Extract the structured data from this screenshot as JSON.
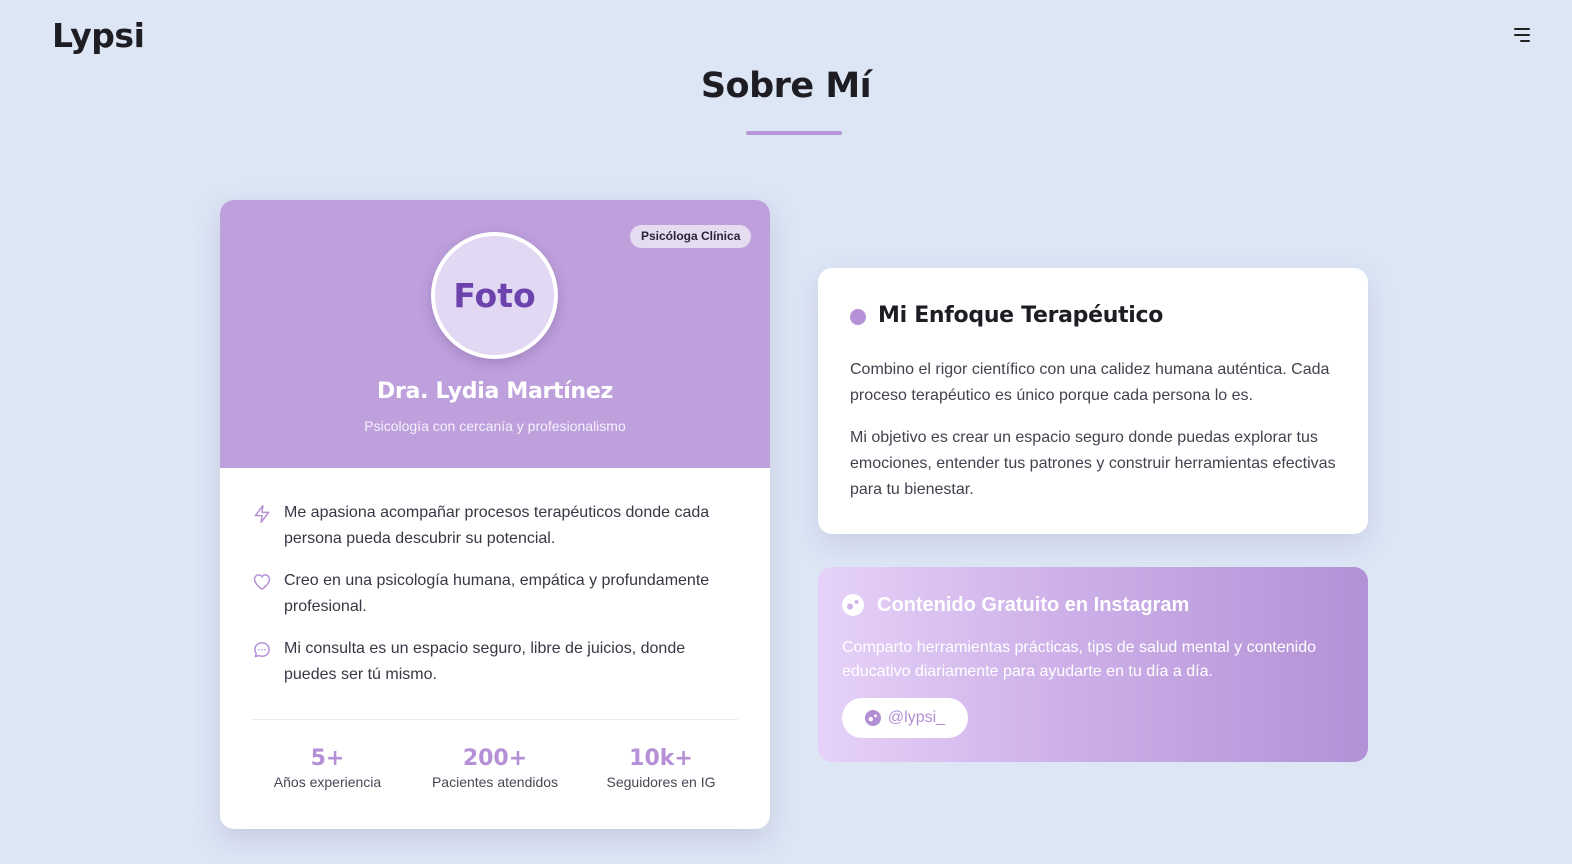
{
  "header": {
    "logo": "Lypsi",
    "menu_icon": "hamburger-menu-icon"
  },
  "section": {
    "title": "Sobre Mí"
  },
  "profile": {
    "badge": "Psicóloga Clínica",
    "photo_label": "Foto",
    "name": "Dra. Lydia Martínez",
    "tagline": "Psicología con cercanía y profesionalismo",
    "traits": [
      {
        "icon": "lightning-icon",
        "text": "Me apasiona acompañar procesos terapéuticos donde cada persona pueda descubrir su potencial."
      },
      {
        "icon": "heart-icon",
        "text": "Creo en una psicología humana, empática y profundamente profesional."
      },
      {
        "icon": "chat-bubble-icon",
        "text": "Mi consulta es un espacio seguro, libre de juicios, donde puedes ser tú mismo."
      }
    ],
    "stats": [
      {
        "value": "5+",
        "label": "Años experiencia"
      },
      {
        "value": "200+",
        "label": "Pacientes atendidos"
      },
      {
        "value": "10k+",
        "label": "Seguidores en IG"
      }
    ]
  },
  "approach": {
    "title": "Mi Enfoque Terapéutico",
    "paragraphs": [
      "Combino el rigor científico con una calidez humana auténtica. Cada proceso terapéutico es único porque cada persona lo es.",
      "Mi objetivo es crear un espacio seguro donde puedas explorar tus emociones, entender tus patrones y construir herramientas efectivas para tu bienestar."
    ]
  },
  "instagram": {
    "icon": "instagram-icon",
    "title": "Contenido Gratuito en Instagram",
    "description": "Comparto herramientas prácticas, tips de salud mental y contenido educativo diariamente para ayudarte en tu día a día.",
    "handle": "@lypsi_"
  },
  "colors": {
    "background": "#dde6f5",
    "accent": "#b590d6",
    "profile_header": "#bea0dc",
    "avatar_text": "#6c42ad"
  }
}
